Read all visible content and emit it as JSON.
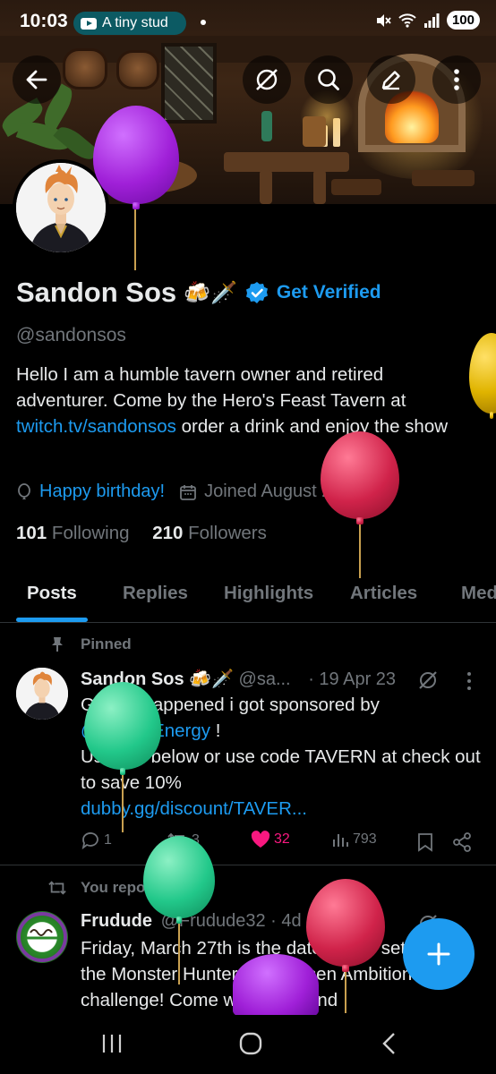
{
  "status_bar": {
    "time": "10:03",
    "chip_text": "A tiny stud",
    "battery": "100"
  },
  "top_bar": {
    "back_icon": "arrow-left-icon",
    "grok_icon": "grok-icon",
    "search_icon": "search-icon",
    "edit_icon": "edit-icon",
    "more_icon": "more-vertical-icon"
  },
  "profile": {
    "display_name": "Sandon Sos",
    "name_emoji": "🍻🗡️",
    "get_verified": "Get Verified",
    "handle": "@sandonsos",
    "bio_1": "Hello I am a humble tavern owner and retired adventurer. Come by the Hero's Feast Tavern at ",
    "bio_link": "twitch.tv/sandonsos",
    "bio_2": " order a drink and enjoy the show",
    "birthday": "Happy birthday!",
    "joined": "Joined August 2014",
    "following_count": "101",
    "following_label": "Following",
    "followers_count": "210",
    "followers_label": "Followers"
  },
  "tabs": [
    "Posts",
    "Replies",
    "Highlights",
    "Articles",
    "Media"
  ],
  "active_tab": "Posts",
  "post1": {
    "pinned_label": "Pinned",
    "author": "Sandon Sos",
    "author_emoji": "🍻🗡️",
    "handle": "@sa...",
    "date": "· 19 Apr 23",
    "text_1": "Guys it happened i got sponsored by",
    "mention": "@DubbyEnergy",
    "text_2": " !",
    "text_3": "Use like below or use code TAVERN at check out to save 10%",
    "link": "dubby.gg/discount/TAVER...",
    "replies": "1",
    "reposts": "3",
    "likes": "32",
    "views": "793"
  },
  "post2": {
    "repost_label": "You reposted",
    "author": "Frudude",
    "handle": "@Frudude32",
    "date": "· 4d",
    "text": "Friday, March 27th is the date that is set the Monster Hunter Rise: Risen Ambition challenge! Come watch me and"
  },
  "colors": {
    "accent": "#1d9bf0",
    "like": "#f91880",
    "muted": "#71767b",
    "balloon_purple": "#a020d8",
    "balloon_red": "#d0234a",
    "balloon_green": "#22c88a",
    "balloon_yellow": "#e0b400"
  }
}
